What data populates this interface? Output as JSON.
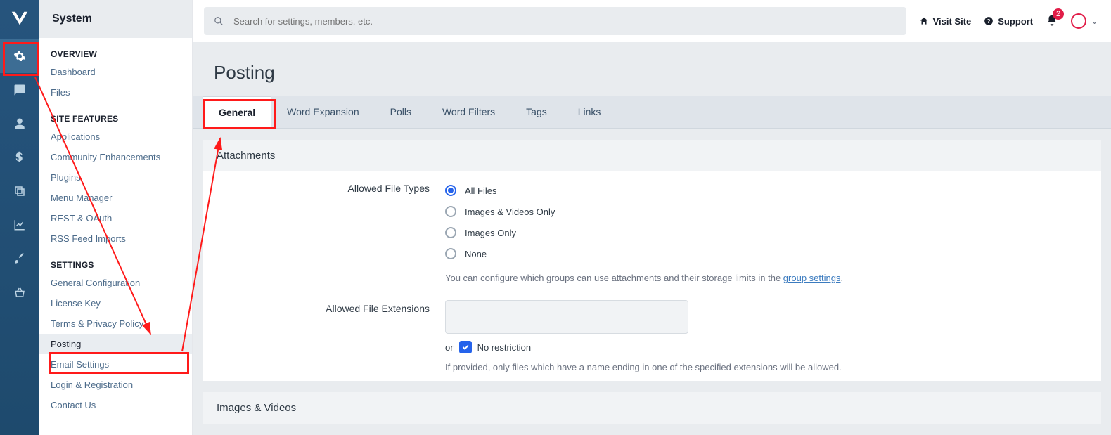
{
  "rail": {
    "items": [
      {
        "name": "settings-icon",
        "active": true
      },
      {
        "name": "comments-icon"
      },
      {
        "name": "user-icon"
      },
      {
        "name": "dollar-icon"
      },
      {
        "name": "copy-icon"
      },
      {
        "name": "chart-icon"
      },
      {
        "name": "brush-icon"
      },
      {
        "name": "basket-icon"
      }
    ]
  },
  "sidebar": {
    "title": "System",
    "groups": [
      {
        "heading": "OVERVIEW",
        "items": [
          {
            "label": "Dashboard"
          },
          {
            "label": "Files"
          }
        ]
      },
      {
        "heading": "SITE FEATURES",
        "items": [
          {
            "label": "Applications"
          },
          {
            "label": "Community Enhancements"
          },
          {
            "label": "Plugins"
          },
          {
            "label": "Menu Manager"
          },
          {
            "label": "REST & OAuth"
          },
          {
            "label": "RSS Feed Imports"
          }
        ]
      },
      {
        "heading": "SETTINGS",
        "items": [
          {
            "label": "General Configuration"
          },
          {
            "label": "License Key"
          },
          {
            "label": "Terms & Privacy Policy"
          },
          {
            "label": "Posting",
            "active": true
          },
          {
            "label": "Email Settings"
          },
          {
            "label": "Login & Registration"
          },
          {
            "label": "Contact Us"
          }
        ]
      }
    ]
  },
  "topbar": {
    "search_placeholder": "Search for settings, members, etc.",
    "visit": "Visit Site",
    "support": "Support",
    "notif_count": "2"
  },
  "page": {
    "title": "Posting"
  },
  "tabs": [
    {
      "label": "General",
      "active": true
    },
    {
      "label": "Word Expansion"
    },
    {
      "label": "Polls"
    },
    {
      "label": "Word Filters"
    },
    {
      "label": "Tags"
    },
    {
      "label": "Links"
    }
  ],
  "panels": {
    "attachments": {
      "heading": "Attachments",
      "allowed_label": "Allowed File Types",
      "options": [
        {
          "label": "All Files",
          "checked": true
        },
        {
          "label": "Images & Videos Only"
        },
        {
          "label": "Images Only"
        },
        {
          "label": "None"
        }
      ],
      "help_pre": "You can configure which groups can use attachments and their storage limits in the ",
      "help_link": "group settings",
      "help_post": ".",
      "ext_label": "Allowed File Extensions",
      "or_text": "or",
      "no_restriction": "No restriction",
      "ext_help": "If provided, only files which have a name ending in one of the specified extensions will be allowed."
    },
    "images": {
      "heading": "Images & Videos"
    }
  }
}
